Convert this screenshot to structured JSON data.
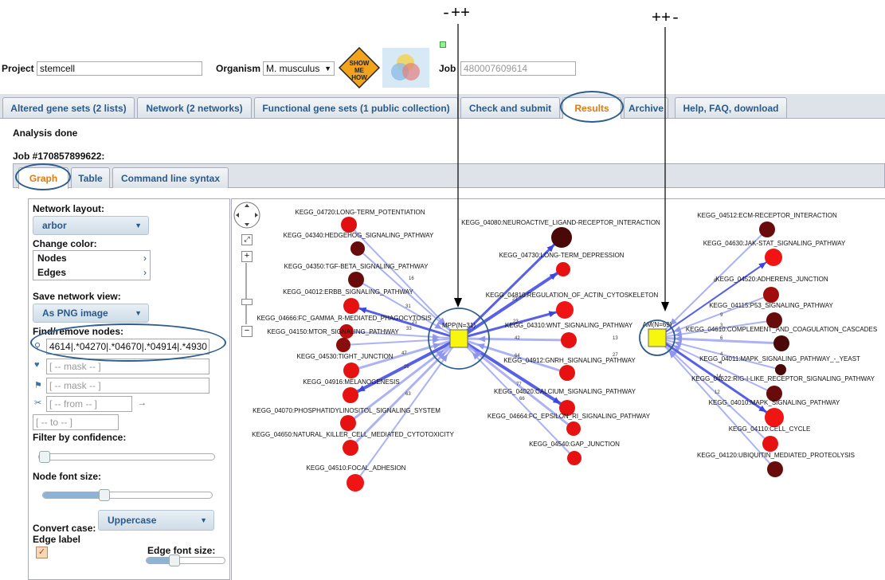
{
  "annotations": {
    "left": "-++",
    "right": "++-"
  },
  "header": {
    "project_label": "Project",
    "project_value": "stemcell",
    "organism_label": "Organism",
    "organism_value": "M. musculus",
    "show_me_how": "SHOW ME HOW",
    "job_label": "Job",
    "job_value": "480007609614"
  },
  "main_tabs": [
    {
      "label": "Altered gene sets (2 lists)"
    },
    {
      "label": "Network (2 networks)"
    },
    {
      "label": "Functional gene sets (1 public collection)"
    },
    {
      "label": "Check and submit"
    },
    {
      "label": "Results"
    },
    {
      "label": "Archive"
    },
    {
      "label": "Help, FAQ, download"
    }
  ],
  "status": "Analysis done",
  "job_heading": "Job #170857899622:",
  "sub_tabs": [
    {
      "label": "Graph"
    },
    {
      "label": "Table"
    },
    {
      "label": "Command line syntax"
    }
  ],
  "panel": {
    "layout_label": "Network layout:",
    "layout_value": "arbor",
    "color_label": "Change color:",
    "color_nodes": "Nodes",
    "color_edges": "Edges",
    "save_label": "Save network view:",
    "save_value": "As PNG image",
    "find_label": "Find/remove nodes:",
    "find_value": "4614|.*04270|.*04670|.*04914|.*4930",
    "mask1_placeholder": "[ -- mask -- ]",
    "mask2_placeholder": "[ -- mask -- ]",
    "from_placeholder": "[ -- from -- ]",
    "to_placeholder": "[ -- to -- ]",
    "confidence_label": "Filter by confidence:",
    "confidence_level": 0.03,
    "fontsize_label": "Node font size:",
    "fontsize_level": 0.36,
    "case_label": "Convert case:",
    "case_value": "Uppercase",
    "edge_label_label": "Edge label",
    "edge_font_label": "Edge font size:",
    "edge_font_level": 0.35
  },
  "graph": {
    "hubs": [
      {
        "label": "MPP(N=31)"
      },
      {
        "label": "AM(N=69)"
      }
    ],
    "nodes": [
      {
        "label": "KEGG_04720:LONG-TERM_POTENTIATION",
        "color": "#e01010"
      },
      {
        "label": "KEGG_04340:HEDGEHOG_SIGNALING_PATHWAY",
        "color": "#6a0b0b"
      },
      {
        "label": "KEGG_04350:TGF-BETA_SIGNALING_PATHWAY",
        "color": "#6a0b0b"
      },
      {
        "label": "KEGG_04012:ERBB_SIGNALING_PATHWAY",
        "color": "#e61212"
      },
      {
        "label": "KEGG_04666:FC_GAMMA_R-MEDIATED_PHAGOCYTOSIS",
        "color": "#c00e0e"
      },
      {
        "label": "KEGG_04150:MTOR_SIGNALING_PATHWAY",
        "color": "#8a0c0c"
      },
      {
        "label": "KEGG_04530:TIGHT_JUNCTION",
        "color": "#e61212"
      },
      {
        "label": "KEGG_04916:MELANOGENESIS",
        "color": "#e61212"
      },
      {
        "label": "KEGG_04070:PHOSPHATIDYLINOSITOL_SIGNALING_SYSTEM",
        "color": "#e61212"
      },
      {
        "label": "KEGG_04650:NATURAL_KILLER_CELL_MEDIATED_CYTOTOXICITY",
        "color": "#e61212"
      },
      {
        "label": "KEGG_04510:FOCAL_ADHESION",
        "color": "#f01414"
      },
      {
        "label": "KEGG_04080:NEUROACTIVE_LIGAND-RECEPTOR_INTERACTION",
        "color": "#4a0808"
      },
      {
        "label": "KEGG_04730:LONG-TERM_DEPRESSION",
        "color": "#e61212"
      },
      {
        "label": "KEGG_04810:REGULATION_OF_ACTIN_CYTOSKELETON",
        "color": "#f01414"
      },
      {
        "label": "KEGG_04310:WNT_SIGNALING_PATHWAY",
        "color": "#e61212"
      },
      {
        "label": "KEGG_04912:GNRH_SIGNALING_PATHWAY",
        "color": "#e61212"
      },
      {
        "label": "KEGG_04020:CALCIUM_SIGNALING_PATHWAY",
        "color": "#e61212"
      },
      {
        "label": "KEGG_04664:FC_EPSILON_RI_SIGNALING_PATHWAY",
        "color": "#e61212"
      },
      {
        "label": "KEGG_04540:GAP_JUNCTION",
        "color": "#e61212"
      },
      {
        "label": "KEGG_04512:ECM-RECEPTOR_INTERACTION",
        "color": "#6a0b0b"
      },
      {
        "label": "KEGG_04630:JAK-STAT_SIGNALING_PATHWAY",
        "color": "#f01414"
      },
      {
        "label": "KEGG_04520:ADHERENS_JUNCTION",
        "color": "#a00d0d"
      },
      {
        "label": "KEGG_04115:P53_SIGNALING_PATHWAY",
        "color": "#6a0b0b"
      },
      {
        "label": "KEGG_04610:COMPLEMENT_AND_COAGULATION_CASCADES",
        "color": "#4a0808"
      },
      {
        "label": "KEGG_04011:MAPK_SIGNALING_PATHWAY_-_YEAST",
        "color": "#4a0808"
      },
      {
        "label": "KEGG_04622:RIG-I-LIKE_RECEPTOR_SIGNALING_PATHWAY",
        "color": "#6a0b0b"
      },
      {
        "label": "KEGG_04010:MAPK_SIGNALING_PATHWAY",
        "color": "#f01414"
      },
      {
        "label": "KEGG_04110:CELL_CYCLE",
        "color": "#e61212"
      },
      {
        "label": "KEGG_04120:UBIQUITIN_MEDIATED_PROTEOLYSIS",
        "color": "#6a0b0b"
      }
    ],
    "edge_labels": [
      "16",
      "31",
      "21",
      "33",
      "47",
      "29",
      "63",
      "21",
      "23",
      "42",
      "64",
      "77",
      "66",
      "13",
      "27",
      "6",
      "9",
      "3",
      "6",
      "4",
      "4",
      "14",
      "12"
    ]
  }
}
